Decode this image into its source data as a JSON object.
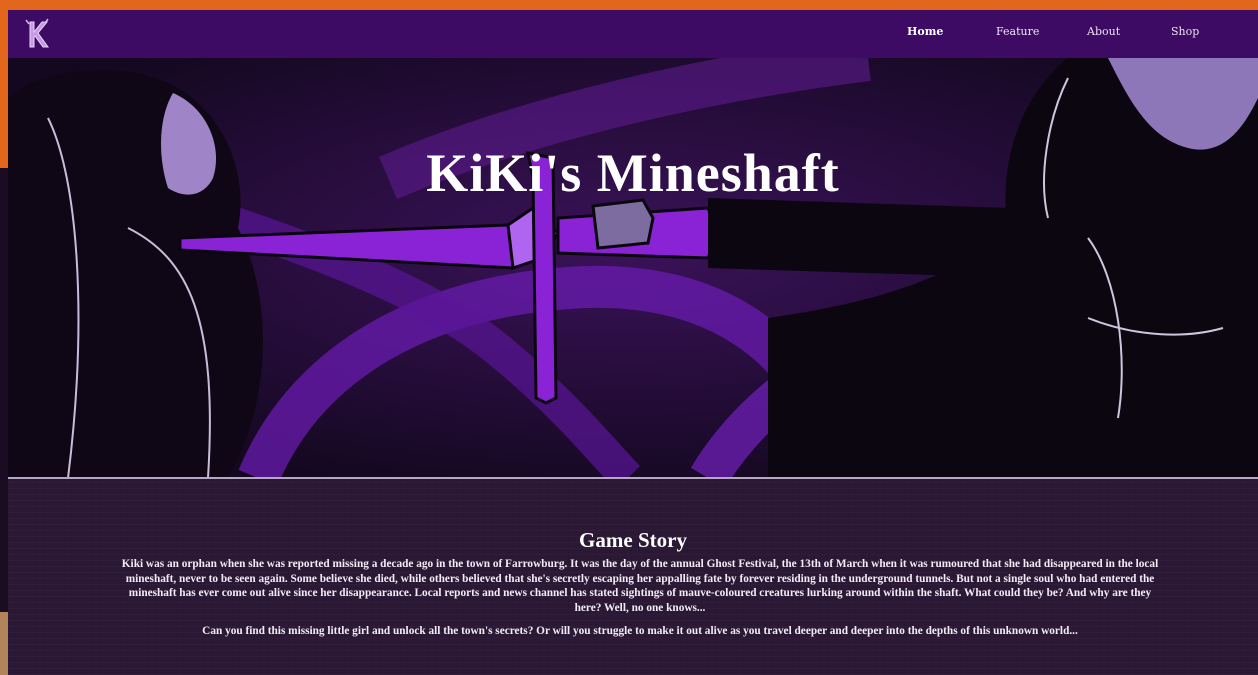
{
  "nav": {
    "logo_alt": "K",
    "links": [
      {
        "label": "Home",
        "active": true
      },
      {
        "label": "Feature",
        "active": false
      },
      {
        "label": "About",
        "active": false
      },
      {
        "label": "Shop",
        "active": false
      }
    ]
  },
  "hero": {
    "title": "KiKi's Mineshaft"
  },
  "story": {
    "heading": "Game Story",
    "paragraph_1": "Kiki was an orphan when she was reported missing a decade ago in the town of Farrowburg. It was the day of the annual Ghost Festival, the 13th of March when it was rumoured that she had disappeared in the local mineshaft, never to be seen again. Some believe she died, while others believed that she's secretly escaping her appalling fate by forever residing in the underground tunnels. But not a single soul who had entered the mineshaft has ever come out alive since her disappearance. Local reports and news channel has stated sightings of mauve-coloured creatures lurking around within the shaft. What could they be? And why are they here? Well, no one knows...",
    "paragraph_2": "Can you find this missing little girl and unlock all the town's secrets? Or will you struggle to make it out alive as you travel deeper and deeper into the depths of this unknown world..."
  },
  "colors": {
    "accent_orange": "#e2661c",
    "nav_purple": "#3d0b63",
    "sword_purple": "#8a23d6",
    "hero_dark": "#1c0d2a"
  }
}
